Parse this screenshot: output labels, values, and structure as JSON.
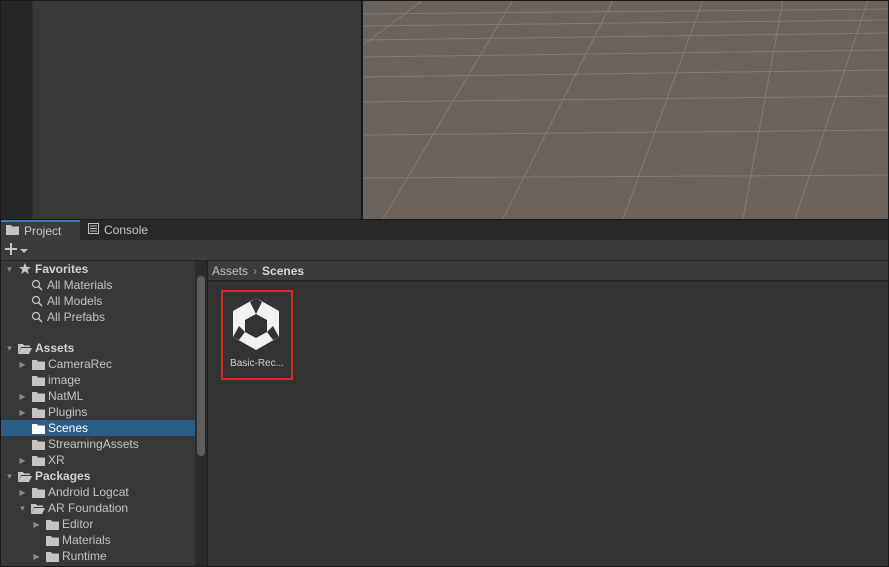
{
  "tabs": [
    {
      "label": "Project",
      "icon": "folder-icon"
    },
    {
      "label": "Console",
      "icon": "console-icon"
    }
  ],
  "toolbar": {
    "add_icon": "plus-icon",
    "dropdown_icon": "chevron-down-icon"
  },
  "tree": {
    "favorites": {
      "label": "Favorites",
      "items": [
        "All Materials",
        "All Models",
        "All Prefabs"
      ]
    },
    "assets": {
      "label": "Assets",
      "items": [
        {
          "label": "CameraRec",
          "expandable": true
        },
        {
          "label": "image",
          "expandable": false
        },
        {
          "label": "NatML",
          "expandable": true
        },
        {
          "label": "Plugins",
          "expandable": true
        },
        {
          "label": "Scenes",
          "expandable": false,
          "selected": true
        },
        {
          "label": "StreamingAssets",
          "expandable": false
        },
        {
          "label": "XR",
          "expandable": true
        }
      ]
    },
    "packages": {
      "label": "Packages",
      "items": [
        {
          "label": "Android Logcat",
          "expandable": true
        },
        {
          "label": "AR Foundation",
          "expandable": true,
          "expanded": true
        },
        {
          "label": "Editor",
          "expandable": true
        },
        {
          "label": "Materials",
          "expandable": false
        },
        {
          "label": "Runtime",
          "expandable": true
        }
      ]
    }
  },
  "breadcrumb": {
    "root": "Assets",
    "separator": "›",
    "current": "Scenes"
  },
  "asset": {
    "label": "Basic-Rec...",
    "icon": "unity-scene-icon"
  },
  "colors": {
    "selection": "#2c5d87",
    "highlight_box": "#e0281e",
    "tab_accent": "#3a79bb"
  }
}
